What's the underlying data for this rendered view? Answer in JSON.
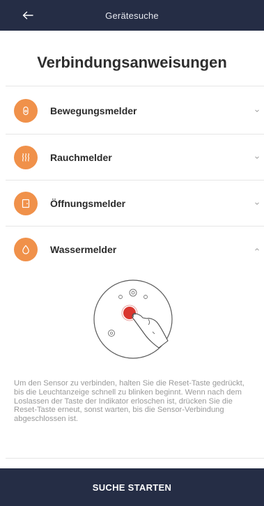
{
  "header": {
    "title": "Gerätesuche",
    "back_icon": "arrow-left-icon"
  },
  "page_title": "Verbindungsanweisungen",
  "accent_color": "#f0914a",
  "header_color": "#252d45",
  "devices": [
    {
      "label": "Bewegungsmelder",
      "icon": "motion-sensor-icon",
      "expanded": false
    },
    {
      "label": "Rauchmelder",
      "icon": "smoke-icon",
      "expanded": false
    },
    {
      "label": "Öffnungsmelder",
      "icon": "door-icon",
      "expanded": false
    },
    {
      "label": "Wassermelder",
      "icon": "water-drop-icon",
      "expanded": true
    }
  ],
  "water_sensor": {
    "instructions": "Um den Sensor zu verbinden, halten Sie die Reset-Taste gedrückt, bis die Leuchtanzeige schnell zu blinken beginnt. Wenn nach dem Loslassen der Taste der Indikator erloschen ist, drücken Sie die Reset-Taste erneut, sonst warten, bis die Sensor-Verbindung abgeschlossen ist."
  },
  "footer": {
    "button_label": "SUCHE STARTEN"
  }
}
